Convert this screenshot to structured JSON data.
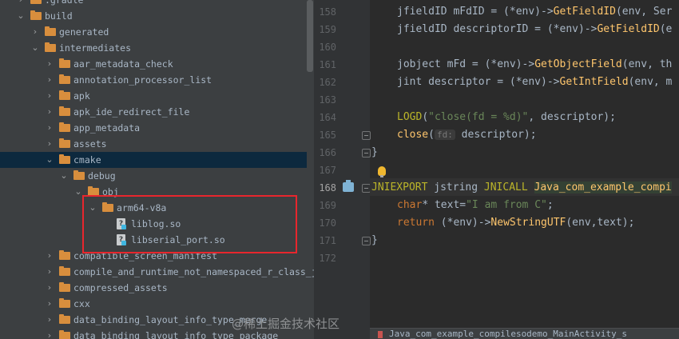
{
  "tree": {
    "items": [
      {
        "label": ".gradle",
        "type": "folder",
        "arrow": "right",
        "depth": 1
      },
      {
        "label": "build",
        "type": "folder",
        "arrow": "down",
        "depth": 1
      },
      {
        "label": "generated",
        "type": "folder",
        "arrow": "right",
        "depth": 2
      },
      {
        "label": "intermediates",
        "type": "folder",
        "arrow": "down",
        "depth": 2
      },
      {
        "label": "aar_metadata_check",
        "type": "folder",
        "arrow": "right",
        "depth": 3
      },
      {
        "label": "annotation_processor_list",
        "type": "folder",
        "arrow": "right",
        "depth": 3
      },
      {
        "label": "apk",
        "type": "folder",
        "arrow": "right",
        "depth": 3
      },
      {
        "label": "apk_ide_redirect_file",
        "type": "folder",
        "arrow": "right",
        "depth": 3
      },
      {
        "label": "app_metadata",
        "type": "folder",
        "arrow": "right",
        "depth": 3
      },
      {
        "label": "assets",
        "type": "folder",
        "arrow": "right",
        "depth": 3
      },
      {
        "label": "cmake",
        "type": "folder",
        "arrow": "down",
        "depth": 3,
        "selected": true
      },
      {
        "label": "debug",
        "type": "folder",
        "arrow": "down",
        "depth": 4
      },
      {
        "label": "obj",
        "type": "folder",
        "arrow": "down",
        "depth": 5
      },
      {
        "label": "arm64-v8a",
        "type": "folder",
        "arrow": "down",
        "depth": 6
      },
      {
        "label": "liblog.so",
        "type": "file",
        "arrow": "",
        "depth": 7
      },
      {
        "label": "libserial_port.so",
        "type": "file",
        "arrow": "",
        "depth": 7
      },
      {
        "label": "compatible_screen_manifest",
        "type": "folder",
        "arrow": "right",
        "depth": 3
      },
      {
        "label": "compile_and_runtime_not_namespaced_r_class_jar",
        "type": "folder",
        "arrow": "right",
        "depth": 3
      },
      {
        "label": "compressed_assets",
        "type": "folder",
        "arrow": "right",
        "depth": 3
      },
      {
        "label": "cxx",
        "type": "folder",
        "arrow": "right",
        "depth": 3
      },
      {
        "label": "data_binding_layout_info_type_merge",
        "type": "folder",
        "arrow": "right",
        "depth": 3
      },
      {
        "label": "data_binding_layout_info_type_package",
        "type": "folder",
        "arrow": "right",
        "depth": 3
      }
    ]
  },
  "editor": {
    "current_line": "168",
    "lines": [
      {
        "num": "158",
        "t": "l158"
      },
      {
        "num": "159",
        "t": "l159"
      },
      {
        "num": "160",
        "t": ""
      },
      {
        "num": "161",
        "t": "l161"
      },
      {
        "num": "162",
        "t": "l162"
      },
      {
        "num": "163",
        "t": ""
      },
      {
        "num": "164",
        "t": "l164"
      },
      {
        "num": "165",
        "t": "l165"
      },
      {
        "num": "166",
        "t": "l166"
      },
      {
        "num": "167",
        "t": ""
      },
      {
        "num": "168",
        "t": "l168"
      },
      {
        "num": "169",
        "t": "l169"
      },
      {
        "num": "170",
        "t": "l170"
      },
      {
        "num": "171",
        "t": "l171"
      },
      {
        "num": "172",
        "t": ""
      }
    ],
    "code": {
      "l158_a": "jfieldID mFdID = (*env)->",
      "l158_f": "GetFieldID",
      "l158_b": "(env, Ser",
      "l159_a": "jfieldID descriptorID = (*env)->",
      "l159_f": "GetFieldID",
      "l159_b": "(e",
      "l161_a": "jobject mFd = (*env)->",
      "l161_f": "GetObjectField",
      "l161_b": "(env, th",
      "l162_a": "jint descriptor = (*env)->",
      "l162_f": "GetIntField",
      "l162_b": "(env, m",
      "l164_m": "LOGD",
      "l164_p": "(",
      "l164_s": "\"close(fd = %d)\"",
      "l164_b": ", descriptor);",
      "l165_f": "close",
      "l165_p": "(",
      "l165_h": "fd:",
      "l165_b": " descriptor);",
      "l166": "}",
      "l168_m1": "JNIEXPORT",
      "l168_a": " jstring ",
      "l168_m2": "JNICALL",
      "l168_sp": " ",
      "l168_f": "Java_com_example_compi",
      "l169_k": "char",
      "l169_a": "* text=",
      "l169_s": "\"I am from C\"",
      "l169_b": ";",
      "l170_k": "return",
      "l170_a": " (*env)->",
      "l170_f": "NewStringUTF",
      "l170_b": "(env,text);",
      "l171": "}"
    },
    "breadcrumb": "Java_com_example_compilesodemo_MainActivity_s"
  },
  "watermark": "@稀土掘金技术社区",
  "colors": {
    "panel_bg": "#3c3f41",
    "editor_bg": "#2b2b2b",
    "selection": "#0d293e",
    "highlight_box": "#e8262d",
    "folder": "#d88e3d"
  },
  "icons": {
    "folder": "folder-icon",
    "file": "unknown-file-icon",
    "bulb": "lightbulb-icon",
    "impl": "implementation-gutter-icon"
  }
}
